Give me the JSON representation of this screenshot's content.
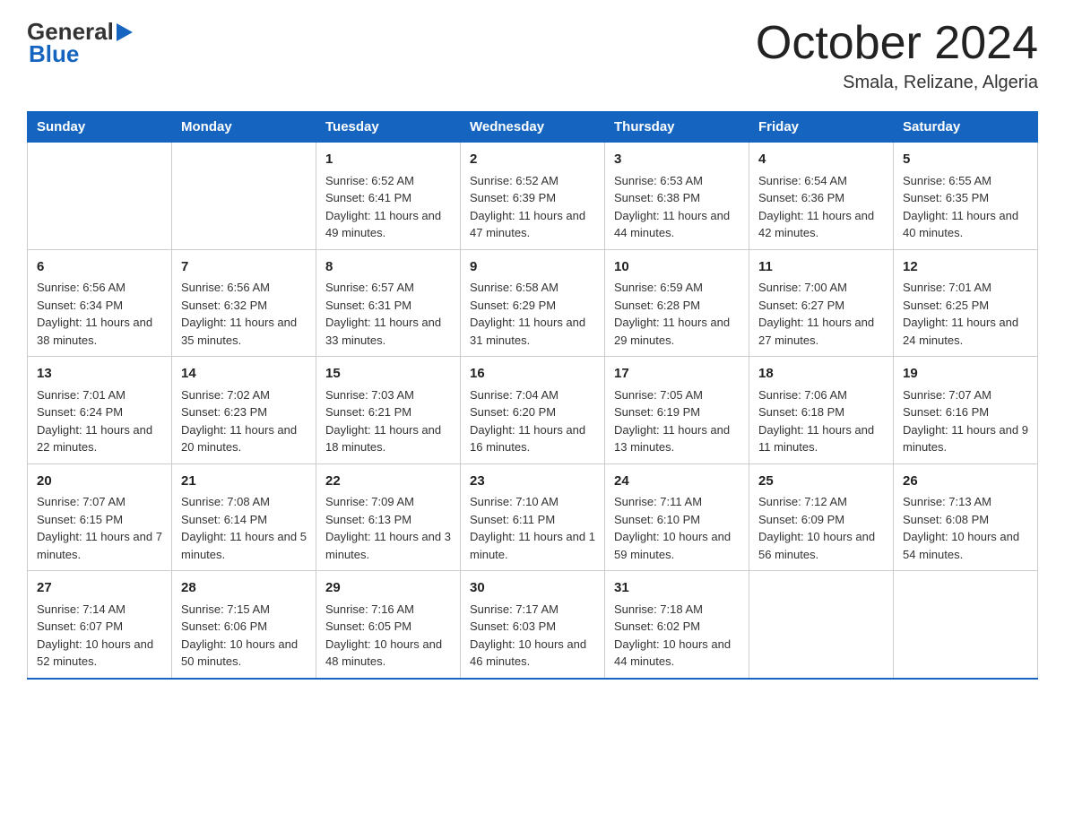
{
  "header": {
    "logo_general": "General",
    "logo_blue": "Blue",
    "month_title": "October 2024",
    "location": "Smala, Relizane, Algeria"
  },
  "days_of_week": [
    "Sunday",
    "Monday",
    "Tuesday",
    "Wednesday",
    "Thursday",
    "Friday",
    "Saturday"
  ],
  "weeks": [
    [
      {
        "day": "",
        "sunrise": "",
        "sunset": "",
        "daylight": ""
      },
      {
        "day": "",
        "sunrise": "",
        "sunset": "",
        "daylight": ""
      },
      {
        "day": "1",
        "sunrise": "Sunrise: 6:52 AM",
        "sunset": "Sunset: 6:41 PM",
        "daylight": "Daylight: 11 hours and 49 minutes."
      },
      {
        "day": "2",
        "sunrise": "Sunrise: 6:52 AM",
        "sunset": "Sunset: 6:39 PM",
        "daylight": "Daylight: 11 hours and 47 minutes."
      },
      {
        "day": "3",
        "sunrise": "Sunrise: 6:53 AM",
        "sunset": "Sunset: 6:38 PM",
        "daylight": "Daylight: 11 hours and 44 minutes."
      },
      {
        "day": "4",
        "sunrise": "Sunrise: 6:54 AM",
        "sunset": "Sunset: 6:36 PM",
        "daylight": "Daylight: 11 hours and 42 minutes."
      },
      {
        "day": "5",
        "sunrise": "Sunrise: 6:55 AM",
        "sunset": "Sunset: 6:35 PM",
        "daylight": "Daylight: 11 hours and 40 minutes."
      }
    ],
    [
      {
        "day": "6",
        "sunrise": "Sunrise: 6:56 AM",
        "sunset": "Sunset: 6:34 PM",
        "daylight": "Daylight: 11 hours and 38 minutes."
      },
      {
        "day": "7",
        "sunrise": "Sunrise: 6:56 AM",
        "sunset": "Sunset: 6:32 PM",
        "daylight": "Daylight: 11 hours and 35 minutes."
      },
      {
        "day": "8",
        "sunrise": "Sunrise: 6:57 AM",
        "sunset": "Sunset: 6:31 PM",
        "daylight": "Daylight: 11 hours and 33 minutes."
      },
      {
        "day": "9",
        "sunrise": "Sunrise: 6:58 AM",
        "sunset": "Sunset: 6:29 PM",
        "daylight": "Daylight: 11 hours and 31 minutes."
      },
      {
        "day": "10",
        "sunrise": "Sunrise: 6:59 AM",
        "sunset": "Sunset: 6:28 PM",
        "daylight": "Daylight: 11 hours and 29 minutes."
      },
      {
        "day": "11",
        "sunrise": "Sunrise: 7:00 AM",
        "sunset": "Sunset: 6:27 PM",
        "daylight": "Daylight: 11 hours and 27 minutes."
      },
      {
        "day": "12",
        "sunrise": "Sunrise: 7:01 AM",
        "sunset": "Sunset: 6:25 PM",
        "daylight": "Daylight: 11 hours and 24 minutes."
      }
    ],
    [
      {
        "day": "13",
        "sunrise": "Sunrise: 7:01 AM",
        "sunset": "Sunset: 6:24 PM",
        "daylight": "Daylight: 11 hours and 22 minutes."
      },
      {
        "day": "14",
        "sunrise": "Sunrise: 7:02 AM",
        "sunset": "Sunset: 6:23 PM",
        "daylight": "Daylight: 11 hours and 20 minutes."
      },
      {
        "day": "15",
        "sunrise": "Sunrise: 7:03 AM",
        "sunset": "Sunset: 6:21 PM",
        "daylight": "Daylight: 11 hours and 18 minutes."
      },
      {
        "day": "16",
        "sunrise": "Sunrise: 7:04 AM",
        "sunset": "Sunset: 6:20 PM",
        "daylight": "Daylight: 11 hours and 16 minutes."
      },
      {
        "day": "17",
        "sunrise": "Sunrise: 7:05 AM",
        "sunset": "Sunset: 6:19 PM",
        "daylight": "Daylight: 11 hours and 13 minutes."
      },
      {
        "day": "18",
        "sunrise": "Sunrise: 7:06 AM",
        "sunset": "Sunset: 6:18 PM",
        "daylight": "Daylight: 11 hours and 11 minutes."
      },
      {
        "day": "19",
        "sunrise": "Sunrise: 7:07 AM",
        "sunset": "Sunset: 6:16 PM",
        "daylight": "Daylight: 11 hours and 9 minutes."
      }
    ],
    [
      {
        "day": "20",
        "sunrise": "Sunrise: 7:07 AM",
        "sunset": "Sunset: 6:15 PM",
        "daylight": "Daylight: 11 hours and 7 minutes."
      },
      {
        "day": "21",
        "sunrise": "Sunrise: 7:08 AM",
        "sunset": "Sunset: 6:14 PM",
        "daylight": "Daylight: 11 hours and 5 minutes."
      },
      {
        "day": "22",
        "sunrise": "Sunrise: 7:09 AM",
        "sunset": "Sunset: 6:13 PM",
        "daylight": "Daylight: 11 hours and 3 minutes."
      },
      {
        "day": "23",
        "sunrise": "Sunrise: 7:10 AM",
        "sunset": "Sunset: 6:11 PM",
        "daylight": "Daylight: 11 hours and 1 minute."
      },
      {
        "day": "24",
        "sunrise": "Sunrise: 7:11 AM",
        "sunset": "Sunset: 6:10 PM",
        "daylight": "Daylight: 10 hours and 59 minutes."
      },
      {
        "day": "25",
        "sunrise": "Sunrise: 7:12 AM",
        "sunset": "Sunset: 6:09 PM",
        "daylight": "Daylight: 10 hours and 56 minutes."
      },
      {
        "day": "26",
        "sunrise": "Sunrise: 7:13 AM",
        "sunset": "Sunset: 6:08 PM",
        "daylight": "Daylight: 10 hours and 54 minutes."
      }
    ],
    [
      {
        "day": "27",
        "sunrise": "Sunrise: 7:14 AM",
        "sunset": "Sunset: 6:07 PM",
        "daylight": "Daylight: 10 hours and 52 minutes."
      },
      {
        "day": "28",
        "sunrise": "Sunrise: 7:15 AM",
        "sunset": "Sunset: 6:06 PM",
        "daylight": "Daylight: 10 hours and 50 minutes."
      },
      {
        "day": "29",
        "sunrise": "Sunrise: 7:16 AM",
        "sunset": "Sunset: 6:05 PM",
        "daylight": "Daylight: 10 hours and 48 minutes."
      },
      {
        "day": "30",
        "sunrise": "Sunrise: 7:17 AM",
        "sunset": "Sunset: 6:03 PM",
        "daylight": "Daylight: 10 hours and 46 minutes."
      },
      {
        "day": "31",
        "sunrise": "Sunrise: 7:18 AM",
        "sunset": "Sunset: 6:02 PM",
        "daylight": "Daylight: 10 hours and 44 minutes."
      },
      {
        "day": "",
        "sunrise": "",
        "sunset": "",
        "daylight": ""
      },
      {
        "day": "",
        "sunrise": "",
        "sunset": "",
        "daylight": ""
      }
    ]
  ]
}
